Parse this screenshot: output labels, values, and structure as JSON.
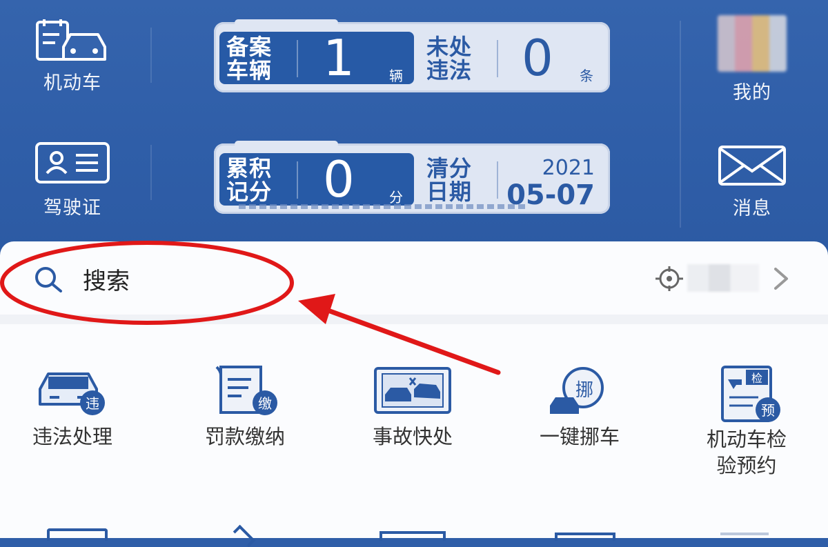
{
  "header": {
    "left_buttons": [
      {
        "label": "机动车",
        "icon": "car-icon"
      },
      {
        "label": "驾驶证",
        "icon": "license-icon"
      }
    ],
    "right_buttons": [
      {
        "label": "我的",
        "icon": "avatar"
      },
      {
        "label": "消息",
        "icon": "envelope-icon"
      }
    ]
  },
  "card_vehicle": {
    "reg_label_1": "备案",
    "reg_label_2": "车辆",
    "reg_value": "1",
    "reg_unit": "辆",
    "viol_label_1": "未处",
    "viol_label_2": "违法",
    "viol_value": "0",
    "viol_unit": "条"
  },
  "card_license": {
    "points_label_1": "累积",
    "points_label_2": "记分",
    "points_value": "0",
    "points_unit": "分",
    "clear_label_1": "清分",
    "clear_label_2": "日期",
    "clear_year": "2021",
    "clear_date": "05-07"
  },
  "search": {
    "placeholder": "搜索"
  },
  "services": [
    {
      "label": "违法处理",
      "icon": "violation-car-icon",
      "badge": "违"
    },
    {
      "label": "罚款缴纳",
      "icon": "fine-scroll-icon",
      "badge": "缴"
    },
    {
      "label": "事故快处",
      "icon": "accident-icon"
    },
    {
      "label": "一键挪车",
      "icon": "move-car-icon",
      "badge": "挪"
    },
    {
      "label": "机动车检验预约",
      "label_line1": "机动车检",
      "label_line2": "验预约",
      "icon": "inspection-icon",
      "badges": [
        "检",
        "预"
      ]
    }
  ],
  "colors": {
    "header_bg": "#2f5ea8",
    "accent": "#2b5aa4",
    "annotation_red": "#e01818"
  }
}
